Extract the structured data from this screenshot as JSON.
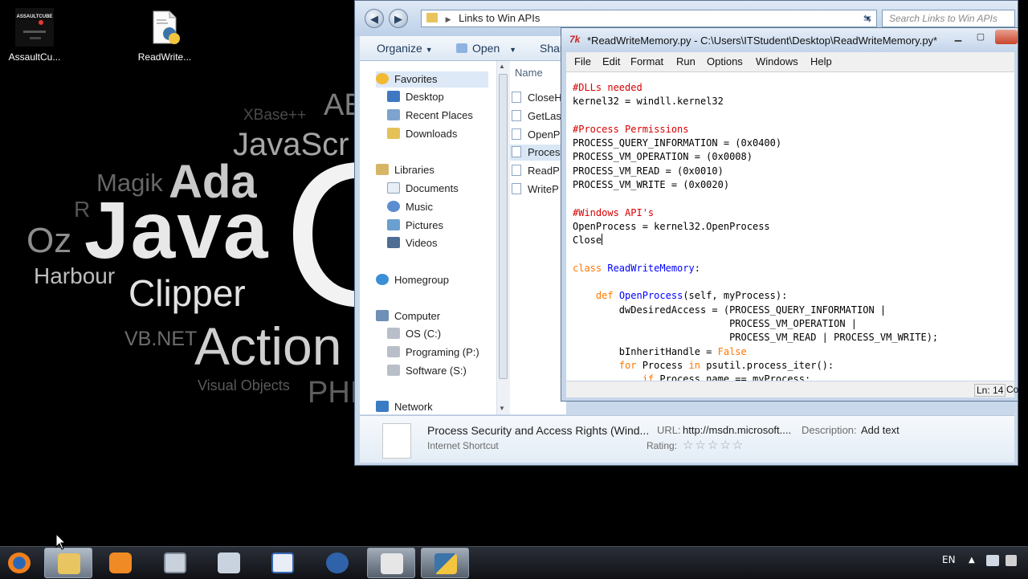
{
  "desktop": {
    "icons": [
      {
        "label": "AssaultCu...",
        "logo_text": "ASSAULTCUBE"
      },
      {
        "label": "ReadWrite..."
      }
    ],
    "word_cloud": [
      "XBase++",
      "AE",
      "JavaScr",
      "Magik",
      "Ada",
      "R",
      "Java",
      "Oz",
      "Harbour",
      "Clipper",
      "VB.NET",
      "Action",
      "Visual Objects",
      "PHI",
      "C"
    ]
  },
  "explorer": {
    "address": "Links to Win APIs",
    "search_placeholder": "Search Links to Win APIs",
    "toolbar": {
      "organize": "Organize",
      "open": "Open",
      "share": "Share"
    },
    "nav": {
      "favorites": "Favorites",
      "favorites_items": [
        "Desktop",
        "Recent Places",
        "Downloads"
      ],
      "libraries": "Libraries",
      "libraries_items": [
        "Documents",
        "Music",
        "Pictures",
        "Videos"
      ],
      "homegroup": "Homegroup",
      "computer": "Computer",
      "drives": [
        "OS (C:)",
        "Programing (P:)",
        "Software (S:)"
      ],
      "network": "Network"
    },
    "column_name": "Name",
    "files": [
      "CloseH",
      "GetLas",
      "OpenP",
      "Proces",
      "ReadP",
      "WriteP"
    ],
    "selected_file_index": 3,
    "details": {
      "title": "Process Security and Access Rights (Wind...",
      "type": "Internet Shortcut",
      "url_label": "URL:",
      "url_value": "http://msdn.microsoft....",
      "desc_label": "Description:",
      "desc_value": "Add text",
      "rating_label": "Rating:",
      "rating_stars": "☆☆☆☆☆",
      "rating_value": 0
    }
  },
  "idle": {
    "title": "*ReadWriteMemory.py - C:\\Users\\ITStudent\\Desktop\\ReadWriteMemory.py*",
    "menu": [
      "File",
      "Edit",
      "Format",
      "Run",
      "Options",
      "Windows",
      "Help"
    ],
    "status": "Ln: 14",
    "status_col": "Co",
    "code_lines": [
      "#DLLs needed",
      "kernel32 = windll.kernel32",
      "",
      "#Process Permissions",
      "PROCESS_QUERY_INFORMATION = (0x0400)",
      "PROCESS_VM_OPERATION = (0x0008)",
      "PROCESS_VM_READ = (0x0010)",
      "PROCESS_VM_WRITE = (0x0020)",
      "",
      "#Windows API's",
      "OpenProcess = kernel32.OpenProcess",
      "Close",
      "",
      "class ReadWriteMemory:",
      "",
      "    def OpenProcess(self, myProcess):",
      "        dwDesiredAccess = (PROCESS_QUERY_INFORMATION |",
      "                           PROCESS_VM_OPERATION |",
      "                           PROCESS_VM_READ | PROCESS_VM_WRITE);",
      "        bInheritHandle = False",
      "        for Process in psutil.process_iter():",
      "            if Process.name == myProcess:"
    ]
  },
  "taskbar": {
    "language": "EN",
    "apps": [
      "firefox",
      "windows-explorer",
      "media-player",
      "idle-shell",
      "calculator",
      "visual-basic",
      "eclipse",
      "video-capture",
      "python"
    ]
  },
  "colors": {
    "code_comment": "#d80000",
    "code_keyword": "#ff7700",
    "code_definition": "#0000ff"
  }
}
